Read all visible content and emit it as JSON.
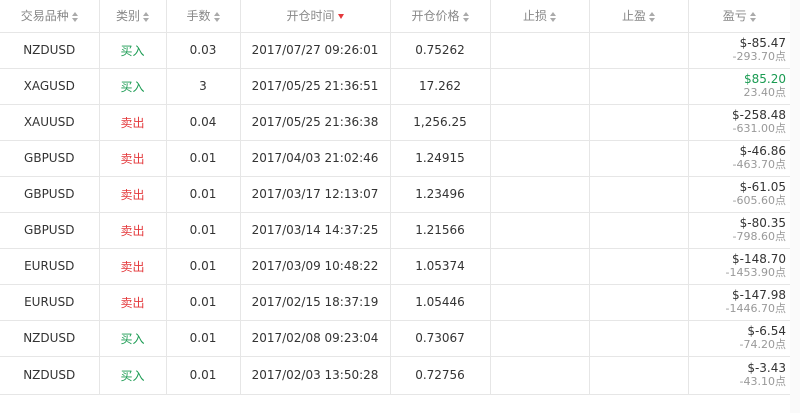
{
  "headers": [
    {
      "label": "交易品种",
      "sort": "both"
    },
    {
      "label": "类别",
      "sort": "both"
    },
    {
      "label": "手数",
      "sort": "both"
    },
    {
      "label": "开仓时间",
      "sort": "desc-active"
    },
    {
      "label": "开仓价格",
      "sort": "both"
    },
    {
      "label": "止损",
      "sort": "both"
    },
    {
      "label": "止盈",
      "sort": "both"
    },
    {
      "label": "盈亏",
      "sort": "both"
    }
  ],
  "rows": [
    {
      "symbol": "NZDUSD",
      "type": "买入",
      "side": "buy",
      "lots": "0.03",
      "open_time": "2017/07/27 09:26:01",
      "open_price": "0.75262",
      "sl": "",
      "tp": "",
      "pnl": "$-85.47",
      "pnl_sign": "neg",
      "points": "-293.70点"
    },
    {
      "symbol": "XAGUSD",
      "type": "买入",
      "side": "buy",
      "lots": "3",
      "open_time": "2017/05/25 21:36:51",
      "open_price": "17.262",
      "sl": "",
      "tp": "",
      "pnl": "$85.20",
      "pnl_sign": "pos",
      "points": "23.40点"
    },
    {
      "symbol": "XAUUSD",
      "type": "卖出",
      "side": "sell",
      "lots": "0.04",
      "open_time": "2017/05/25 21:36:38",
      "open_price": "1,256.25",
      "sl": "",
      "tp": "",
      "pnl": "$-258.48",
      "pnl_sign": "neg",
      "points": "-631.00点"
    },
    {
      "symbol": "GBPUSD",
      "type": "卖出",
      "side": "sell",
      "lots": "0.01",
      "open_time": "2017/04/03 21:02:46",
      "open_price": "1.24915",
      "sl": "",
      "tp": "",
      "pnl": "$-46.86",
      "pnl_sign": "neg",
      "points": "-463.70点"
    },
    {
      "symbol": "GBPUSD",
      "type": "卖出",
      "side": "sell",
      "lots": "0.01",
      "open_time": "2017/03/17 12:13:07",
      "open_price": "1.23496",
      "sl": "",
      "tp": "",
      "pnl": "$-61.05",
      "pnl_sign": "neg",
      "points": "-605.60点"
    },
    {
      "symbol": "GBPUSD",
      "type": "卖出",
      "side": "sell",
      "lots": "0.01",
      "open_time": "2017/03/14 14:37:25",
      "open_price": "1.21566",
      "sl": "",
      "tp": "",
      "pnl": "$-80.35",
      "pnl_sign": "neg",
      "points": "-798.60点"
    },
    {
      "symbol": "EURUSD",
      "type": "卖出",
      "side": "sell",
      "lots": "0.01",
      "open_time": "2017/03/09 10:48:22",
      "open_price": "1.05374",
      "sl": "",
      "tp": "",
      "pnl": "$-148.70",
      "pnl_sign": "neg",
      "points": "-1453.90点"
    },
    {
      "symbol": "EURUSD",
      "type": "卖出",
      "side": "sell",
      "lots": "0.01",
      "open_time": "2017/02/15 18:37:19",
      "open_price": "1.05446",
      "sl": "",
      "tp": "",
      "pnl": "$-147.98",
      "pnl_sign": "neg",
      "points": "-1446.70点"
    },
    {
      "symbol": "NZDUSD",
      "type": "买入",
      "side": "buy",
      "lots": "0.01",
      "open_time": "2017/02/08 09:23:04",
      "open_price": "0.73067",
      "sl": "",
      "tp": "",
      "pnl": "$-6.54",
      "pnl_sign": "neg",
      "points": "-74.20点"
    },
    {
      "symbol": "NZDUSD",
      "type": "买入",
      "side": "buy",
      "lots": "0.01",
      "open_time": "2017/02/03 13:50:28",
      "open_price": "0.72756",
      "sl": "",
      "tp": "",
      "pnl": "$-3.43",
      "pnl_sign": "neg",
      "points": "-43.10点"
    }
  ],
  "colors": {
    "buy": "#1a9b52",
    "sell": "#e4393c",
    "sort_active": "#e4393c",
    "border": "#e6e6e6"
  }
}
